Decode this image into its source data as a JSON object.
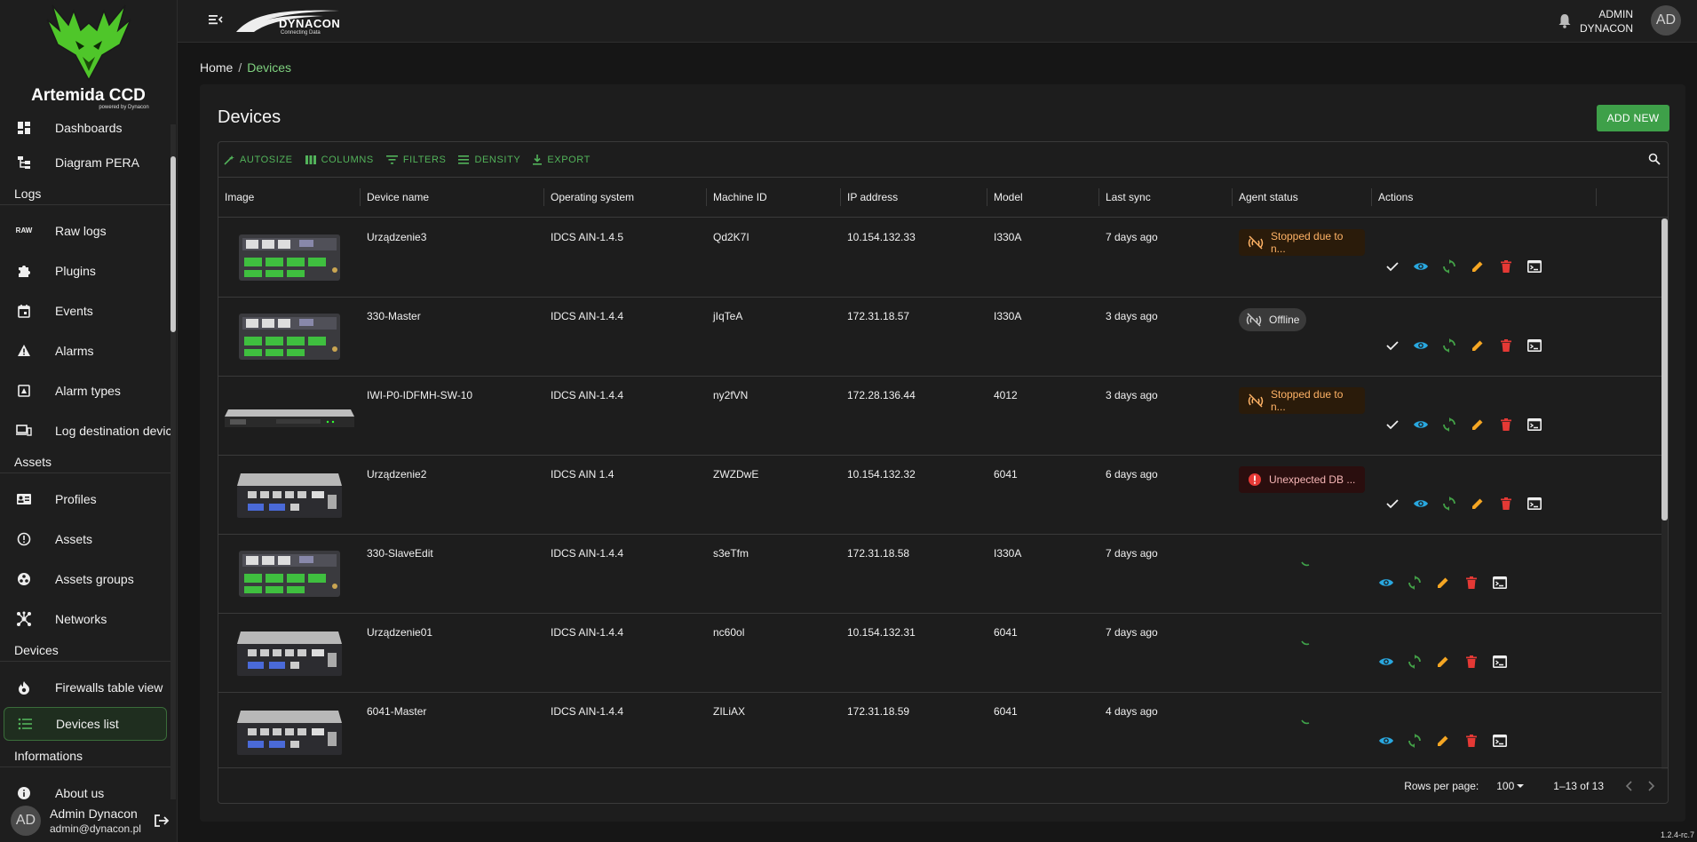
{
  "brand": {
    "title": "Artemida CCD",
    "subtitle": "powered by Dynacon"
  },
  "topbar": {
    "logo_text": "DYNACON",
    "logo_tagline": "Connecting Data",
    "user_line1": "ADMIN",
    "user_line2": "DYNACON",
    "avatar": "AD"
  },
  "sidebar": {
    "items_top": [
      {
        "label": "Dashboards",
        "icon": "dashboard-icon"
      },
      {
        "label": "Diagram PERA",
        "icon": "diagram-icon"
      }
    ],
    "section_logs": "Logs",
    "items_logs": [
      {
        "label": "Raw logs",
        "icon": "raw-icon",
        "icon_text": "RAW"
      },
      {
        "label": "Plugins",
        "icon": "puzzle-icon"
      },
      {
        "label": "Events",
        "icon": "calendar-icon"
      },
      {
        "label": "Alarms",
        "icon": "warning-icon"
      },
      {
        "label": "Alarm types",
        "icon": "alarm-type-icon"
      },
      {
        "label": "Log destination device",
        "icon": "devices-icon"
      }
    ],
    "section_assets": "Assets",
    "items_assets": [
      {
        "label": "Profiles",
        "icon": "profile-card-icon"
      },
      {
        "label": "Assets",
        "icon": "info-circle-icon"
      },
      {
        "label": "Assets groups",
        "icon": "groups-icon"
      },
      {
        "label": "Networks",
        "icon": "network-icon"
      }
    ],
    "section_devices": "Devices",
    "items_devices": [
      {
        "label": "Firewalls table view",
        "icon": "flame-icon"
      },
      {
        "label": "Devices list",
        "icon": "list-icon"
      }
    ],
    "section_info": "Informations",
    "items_info": [
      {
        "label": "About us",
        "icon": "info-icon"
      }
    ],
    "user": {
      "name": "Admin Dynacon",
      "email": "admin@dynacon.pl",
      "avatar": "AD"
    }
  },
  "breadcrumb": {
    "home": "Home",
    "separator": "/",
    "current": "Devices"
  },
  "main": {
    "title": "Devices",
    "add_button": "ADD NEW",
    "toolbar": [
      "AUTOSIZE",
      "COLUMNS",
      "FILTERS",
      "DENSITY",
      "EXPORT"
    ],
    "columns": [
      "Image",
      "Device name",
      "Operating system",
      "Machine ID",
      "IP address",
      "Model",
      "Last sync",
      "Agent status",
      "Actions"
    ],
    "rows": [
      {
        "image": "module",
        "name": "Urządzenie3",
        "os": "IDCS AIN-1.4.5",
        "machine_id": "Qd2K7I",
        "ip": "10.154.132.33",
        "model": "I330A",
        "last_sync": "7 days ago",
        "status": "Stopped due to n...",
        "status_type": "warn",
        "has_check": true
      },
      {
        "image": "module",
        "name": "330-Master",
        "os": "IDCS AIN-1.4.4",
        "machine_id": "jIqTeA",
        "ip": "172.31.18.57",
        "model": "I330A",
        "last_sync": "3 days ago",
        "status": "Offline",
        "status_type": "offline",
        "has_check": true
      },
      {
        "image": "switch",
        "name": "IWI-P0-IDFMH-SW-10",
        "os": "IDCS AIN-1.4.4",
        "machine_id": "ny2fVN",
        "ip": "172.28.136.44",
        "model": "4012",
        "last_sync": "3 days ago",
        "status": "Stopped due to n...",
        "status_type": "warn",
        "has_check": true
      },
      {
        "image": "box",
        "name": "Urządzenie2",
        "os": "IDCS AIN 1.4",
        "machine_id": "ZWZDwE",
        "ip": "10.154.132.32",
        "model": "6041",
        "last_sync": "6 days ago",
        "status": "Unexpected DB ...",
        "status_type": "error",
        "has_check": true
      },
      {
        "image": "module",
        "name": "330-SlaveEdit",
        "os": "IDCS AIN-1.4.4",
        "machine_id": "s3eTfm",
        "ip": "172.31.18.58",
        "model": "I330A",
        "last_sync": "7 days ago",
        "status": "",
        "status_type": "loading",
        "has_check": false
      },
      {
        "image": "box",
        "name": "Urządzenie01",
        "os": "IDCS AIN-1.4.4",
        "machine_id": "nc60ol",
        "ip": "10.154.132.31",
        "model": "6041",
        "last_sync": "7 days ago",
        "status": "",
        "status_type": "loading",
        "has_check": false
      },
      {
        "image": "box",
        "name": "6041-Master",
        "os": "IDCS AIN-1.4.4",
        "machine_id": "ZILiAX",
        "ip": "172.31.18.59",
        "model": "6041",
        "last_sync": "4 days ago",
        "status": "",
        "status_type": "loading",
        "has_check": false
      }
    ],
    "footer": {
      "rows_per_page_label": "Rows per page:",
      "rows_per_page": "100",
      "range": "1–13 of 13"
    }
  },
  "version": "1.2.4-rc.7",
  "colors": {
    "accent": "#3ea049",
    "accent_text": "#52b35a",
    "warn": "#ffb366",
    "error": "#e53935",
    "view": "#29a8e0",
    "sync": "#43a047",
    "edit": "#f5a623",
    "delete": "#e53935"
  }
}
